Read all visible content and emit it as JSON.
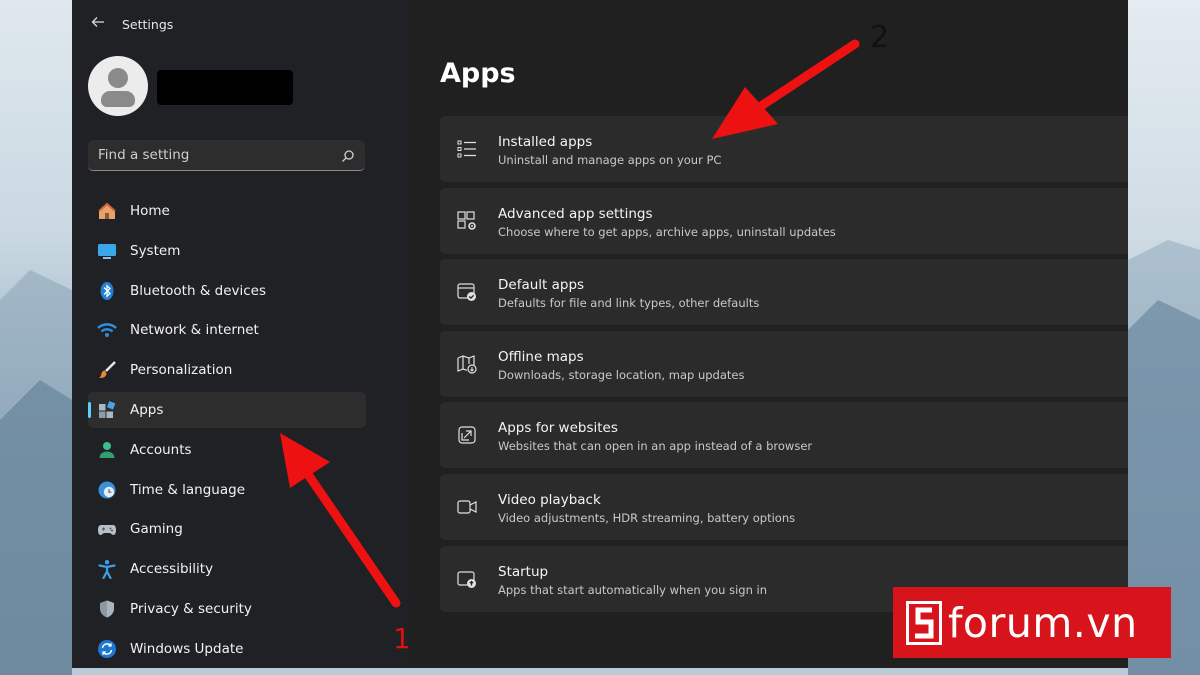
{
  "window": {
    "title": "Settings"
  },
  "search": {
    "placeholder": "Find a setting"
  },
  "sidebar": {
    "items": [
      {
        "label": "Home",
        "icon": "home-icon"
      },
      {
        "label": "System",
        "icon": "system-icon"
      },
      {
        "label": "Bluetooth & devices",
        "icon": "bluetooth-icon"
      },
      {
        "label": "Network & internet",
        "icon": "wifi-icon"
      },
      {
        "label": "Personalization",
        "icon": "brush-icon"
      },
      {
        "label": "Apps",
        "icon": "apps-icon",
        "active": true
      },
      {
        "label": "Accounts",
        "icon": "account-icon"
      },
      {
        "label": "Time & language",
        "icon": "globe-clock-icon"
      },
      {
        "label": "Gaming",
        "icon": "gamepad-icon"
      },
      {
        "label": "Accessibility",
        "icon": "accessibility-icon"
      },
      {
        "label": "Privacy & security",
        "icon": "shield-icon"
      },
      {
        "label": "Windows Update",
        "icon": "update-icon"
      }
    ]
  },
  "main": {
    "title": "Apps",
    "cards": [
      {
        "title": "Installed apps",
        "subtitle": "Uninstall and manage apps on your PC",
        "icon": "list-icon"
      },
      {
        "title": "Advanced app settings",
        "subtitle": "Choose where to get apps, archive apps, uninstall updates",
        "icon": "app-settings-icon"
      },
      {
        "title": "Default apps",
        "subtitle": "Defaults for file and link types, other defaults",
        "icon": "default-apps-icon"
      },
      {
        "title": "Offline maps",
        "subtitle": "Downloads, storage location, map updates",
        "icon": "map-icon"
      },
      {
        "title": "Apps for websites",
        "subtitle": "Websites that can open in an app instead of a browser",
        "icon": "open-external-icon"
      },
      {
        "title": "Video playback",
        "subtitle": "Video adjustments, HDR streaming, battery options",
        "icon": "video-icon"
      },
      {
        "title": "Startup",
        "subtitle": "Apps that start automatically when you sign in",
        "icon": "startup-icon"
      }
    ]
  },
  "annotations": {
    "step1": "1",
    "step2": "2",
    "arrow_color": "#ee1111"
  },
  "watermark": {
    "text": "forum.vn",
    "color": "#d7141c"
  },
  "colors": {
    "accent": "#60cdff",
    "window_bg": "#202020",
    "card_bg": "#2b2b2b"
  }
}
